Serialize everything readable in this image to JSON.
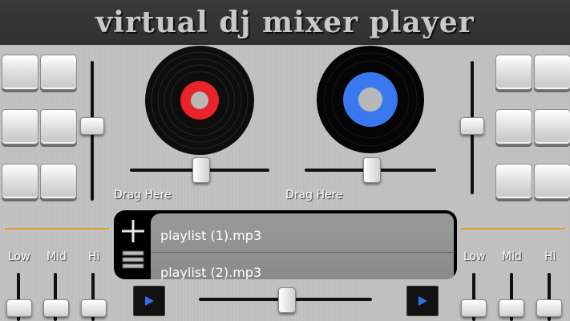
{
  "app": {
    "title": "virtual dj mixer player"
  },
  "decks": [
    {
      "drag_label": "Drag Here",
      "center_color": "#e8232a"
    },
    {
      "drag_label": "Drag Here",
      "center_color": "#3a78f0"
    }
  ],
  "eq": {
    "left": {
      "low": "Low",
      "mid": "Mid",
      "hi": "Hi"
    },
    "right": {
      "low": "Low",
      "mid": "Mid",
      "hi": "Hi"
    }
  },
  "playlist": {
    "items": [
      "playlist (1).mp3",
      "playlist (2).mp3"
    ]
  },
  "colors": {
    "accent_line": "#e0a030",
    "play_icon": "#2f6ee8"
  }
}
